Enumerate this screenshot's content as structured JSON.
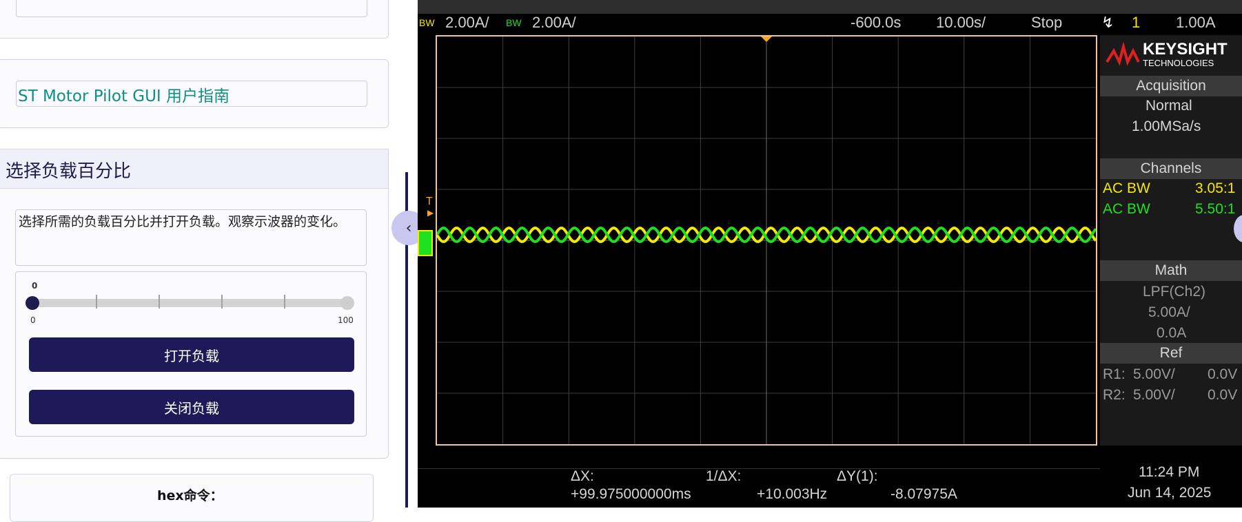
{
  "left_panel": {
    "guide_link": "ST Motor Pilot GUI 用户指南",
    "load_section_title": "选择负载百分比",
    "load_description": "选择所需的负载百分比并打开负载。观察示波器的变化。",
    "slider": {
      "current_value": "0",
      "min": "0",
      "max": "100",
      "value_fraction": 0
    },
    "open_load_button": "打开负载",
    "close_load_button": "关闭负载",
    "hex_command_label": "hex命令："
  },
  "scope": {
    "ch1_bw": "BW",
    "ch1_scale": "2.00A/",
    "ch2_bw": "BW",
    "ch2_scale": "2.00A/",
    "trigger_delay": "-600.0s",
    "timebase": "10.00s/",
    "run_state": "Stop",
    "trigger_channel": "1",
    "trigger_level": "1.00A",
    "brand": "KEYSIGHT",
    "brand_sub": "TECHNOLOGIES",
    "acquisition": {
      "title": "Acquisition",
      "mode": "Normal",
      "rate": "1.00MSa/s"
    },
    "channels": {
      "title": "Channels",
      "rows": [
        {
          "label": "AC BW",
          "probe": "3.05:1",
          "color": "#f5e900"
        },
        {
          "label": "AC BW",
          "probe": "5.50:1",
          "color": "#1ee01e"
        }
      ]
    },
    "math": {
      "title": "Math",
      "func": "LPF(Ch2)",
      "scale": "5.00A/",
      "offset": "0.0A"
    },
    "ref": {
      "title": "Ref",
      "rows": [
        {
          "label": "R1:",
          "scale": "5.00V/",
          "offset": "0.0V"
        },
        {
          "label": "R2:",
          "scale": "5.00V/",
          "offset": "0.0V"
        }
      ]
    },
    "cursors": {
      "dx_label": "ΔX:",
      "dx_value": "+99.975000000ms",
      "inv_dx_label": "1/ΔX:",
      "inv_dx_value": "+10.003Hz",
      "dy_label": "ΔY(1):",
      "dy_value": "-8.07975A"
    },
    "time": "11:24 PM",
    "date": "Jun 14, 2025",
    "trigger_marker": "T",
    "colors": {
      "ch1": "#f5e900",
      "ch2": "#1ee01e",
      "trigger": "#f5a623"
    }
  }
}
